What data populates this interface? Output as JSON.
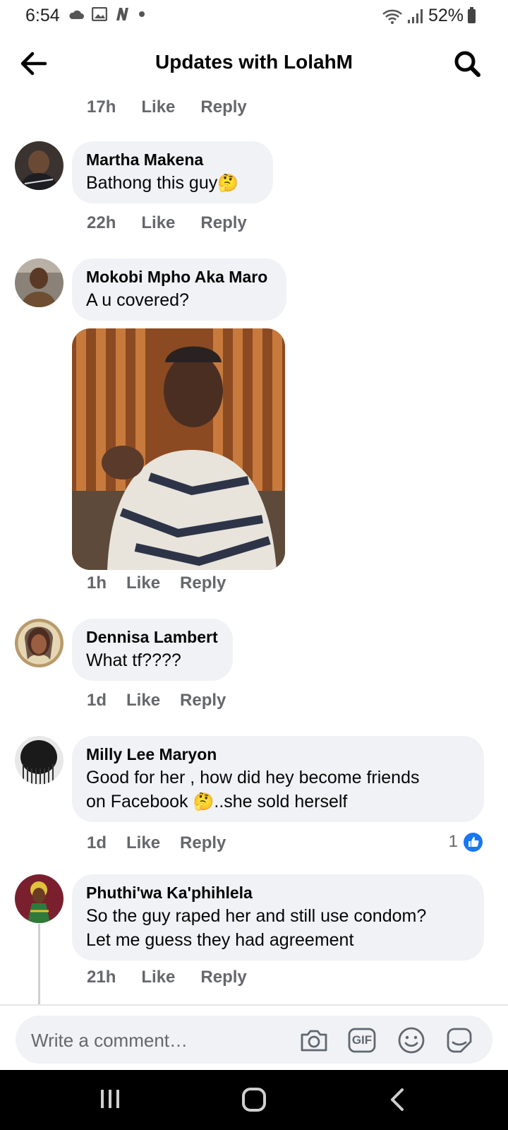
{
  "status": {
    "time": "6:54",
    "battery": "52%"
  },
  "header": {
    "title": "Updates with LolahM"
  },
  "top_meta": {
    "time": "17h",
    "like": "Like",
    "reply": "Reply"
  },
  "comments": [
    {
      "author": "Martha Makena",
      "text": "Bathong this guy",
      "emoji": "🤔",
      "time": "22h",
      "like": "Like",
      "reply": "Reply"
    },
    {
      "author": "Mokobi Mpho Aka Maro",
      "text": "A u covered?",
      "time": "1h",
      "like": "Like",
      "reply": "Reply"
    },
    {
      "author": "Dennisa Lambert",
      "text": "What tf????",
      "time": "1d",
      "like": "Like",
      "reply": "Reply"
    },
    {
      "author": "Milly Lee Maryon",
      "text_line1": "Good for her , how did hey become friends",
      "text_line2a": "on Facebook ",
      "emoji": "🤔",
      "text_line2b": "..she sold herself",
      "time": "1d",
      "like": "Like",
      "reply": "Reply",
      "reaction_count": "1"
    },
    {
      "author": "Phuthi'wa Ka'phihlela",
      "text_line1": "So the guy raped her and still use condom?",
      "text_line2": "Let me guess they had agreement",
      "time": "21h",
      "like": "Like",
      "reply": "Reply"
    }
  ],
  "composer": {
    "placeholder": "Write a comment…",
    "gif_label": "GIF"
  },
  "colors": {
    "accent": "#1877f2",
    "bubble": "#f0f2f5",
    "secondary_text": "#65676b"
  }
}
